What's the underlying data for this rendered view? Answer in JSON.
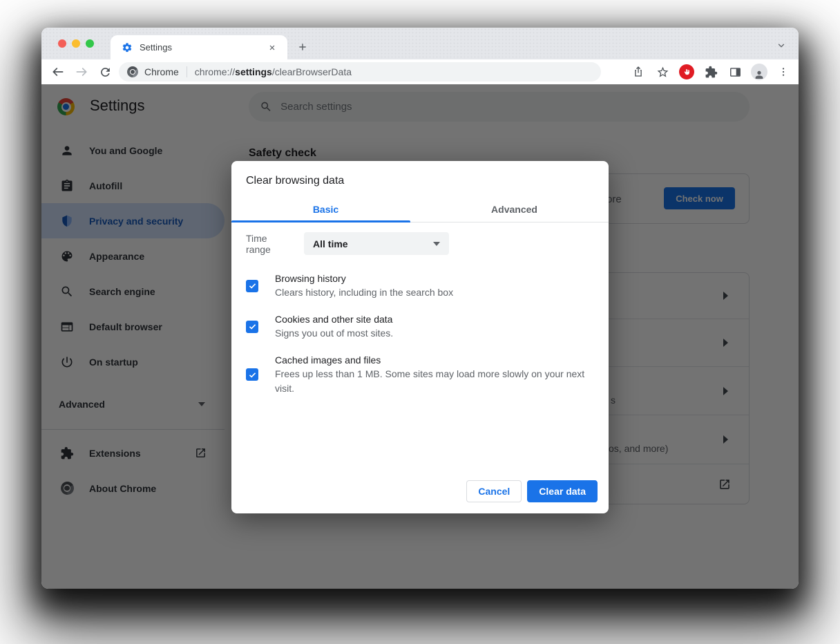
{
  "colors": {
    "accent_blue": "#1a73e8",
    "selected_sidebar_bg": "#d2e3fc",
    "selected_sidebar_text": "#185abc",
    "traffic_red": "#f35f58",
    "traffic_yellow": "#fbbd2e",
    "traffic_green": "#32c749",
    "adblock_red": "#e01c24",
    "dim_overlay": "rgba(0,0,0,0.55)"
  },
  "icons": {
    "tab_favicon": "gear-icon",
    "omnibox_site": "chrome-logo-mono",
    "toolbar": [
      "back-arrow",
      "forward-arrow",
      "reload",
      "share",
      "star-outline",
      "adblock-hand",
      "puzzle-piece",
      "side-panel",
      "person-avatar",
      "kebab-menu"
    ],
    "sidebar": [
      "person",
      "clipboard",
      "shield-half",
      "palette",
      "magnifier",
      "browser-window",
      "power",
      "puzzle-piece",
      "chrome-logo"
    ],
    "row_markers": [
      "chevron-right",
      "open-in-new"
    ]
  },
  "tab_strip": {
    "tab_title": "Settings"
  },
  "toolbar": {
    "site_label": "Chrome",
    "url_prefix": "chrome://",
    "url_bold": "settings",
    "url_suffix": "/clearBrowserData"
  },
  "settings_page": {
    "header": {
      "title": "Settings",
      "search_placeholder": "Search settings"
    },
    "sidebar": {
      "items": [
        {
          "label": "You and Google",
          "icon": "person-icon",
          "selected": false
        },
        {
          "label": "Autofill",
          "icon": "clipboard-icon",
          "selected": false
        },
        {
          "label": "Privacy and security",
          "icon": "shield-icon",
          "selected": true
        },
        {
          "label": "Appearance",
          "icon": "palette-icon",
          "selected": false
        },
        {
          "label": "Search engine",
          "icon": "magnifier-icon",
          "selected": false
        },
        {
          "label": "Default browser",
          "icon": "browser-window-icon",
          "selected": false
        },
        {
          "label": "On startup",
          "icon": "power-icon",
          "selected": false
        }
      ],
      "advanced_label": "Advanced",
      "footer_items": [
        {
          "label": "Extensions",
          "icon": "puzzle-icon",
          "external": true
        },
        {
          "label": "About Chrome",
          "icon": "chrome-logo-icon",
          "external": false
        }
      ]
    },
    "content": {
      "safety_check_heading": "Safety check",
      "check_now_label": "Check now",
      "fragments": {
        "safety_card": "ore",
        "security_row": "s",
        "site_settings_row": "os, and more)"
      }
    }
  },
  "dialog": {
    "title": "Clear browsing data",
    "tabs": [
      {
        "label": "Basic",
        "active": true
      },
      {
        "label": "Advanced",
        "active": false
      }
    ],
    "time_range": {
      "label": "Time range",
      "value": "All time"
    },
    "options": [
      {
        "title": "Browsing history",
        "description": "Clears history, including in the search box",
        "checked": true
      },
      {
        "title": "Cookies and other site data",
        "description": "Signs you out of most sites.",
        "checked": true
      },
      {
        "title": "Cached images and files",
        "description": "Frees up less than 1 MB. Some sites may load more slowly on your next visit.",
        "checked": true
      }
    ],
    "cancel_label": "Cancel",
    "confirm_label": "Clear data"
  }
}
